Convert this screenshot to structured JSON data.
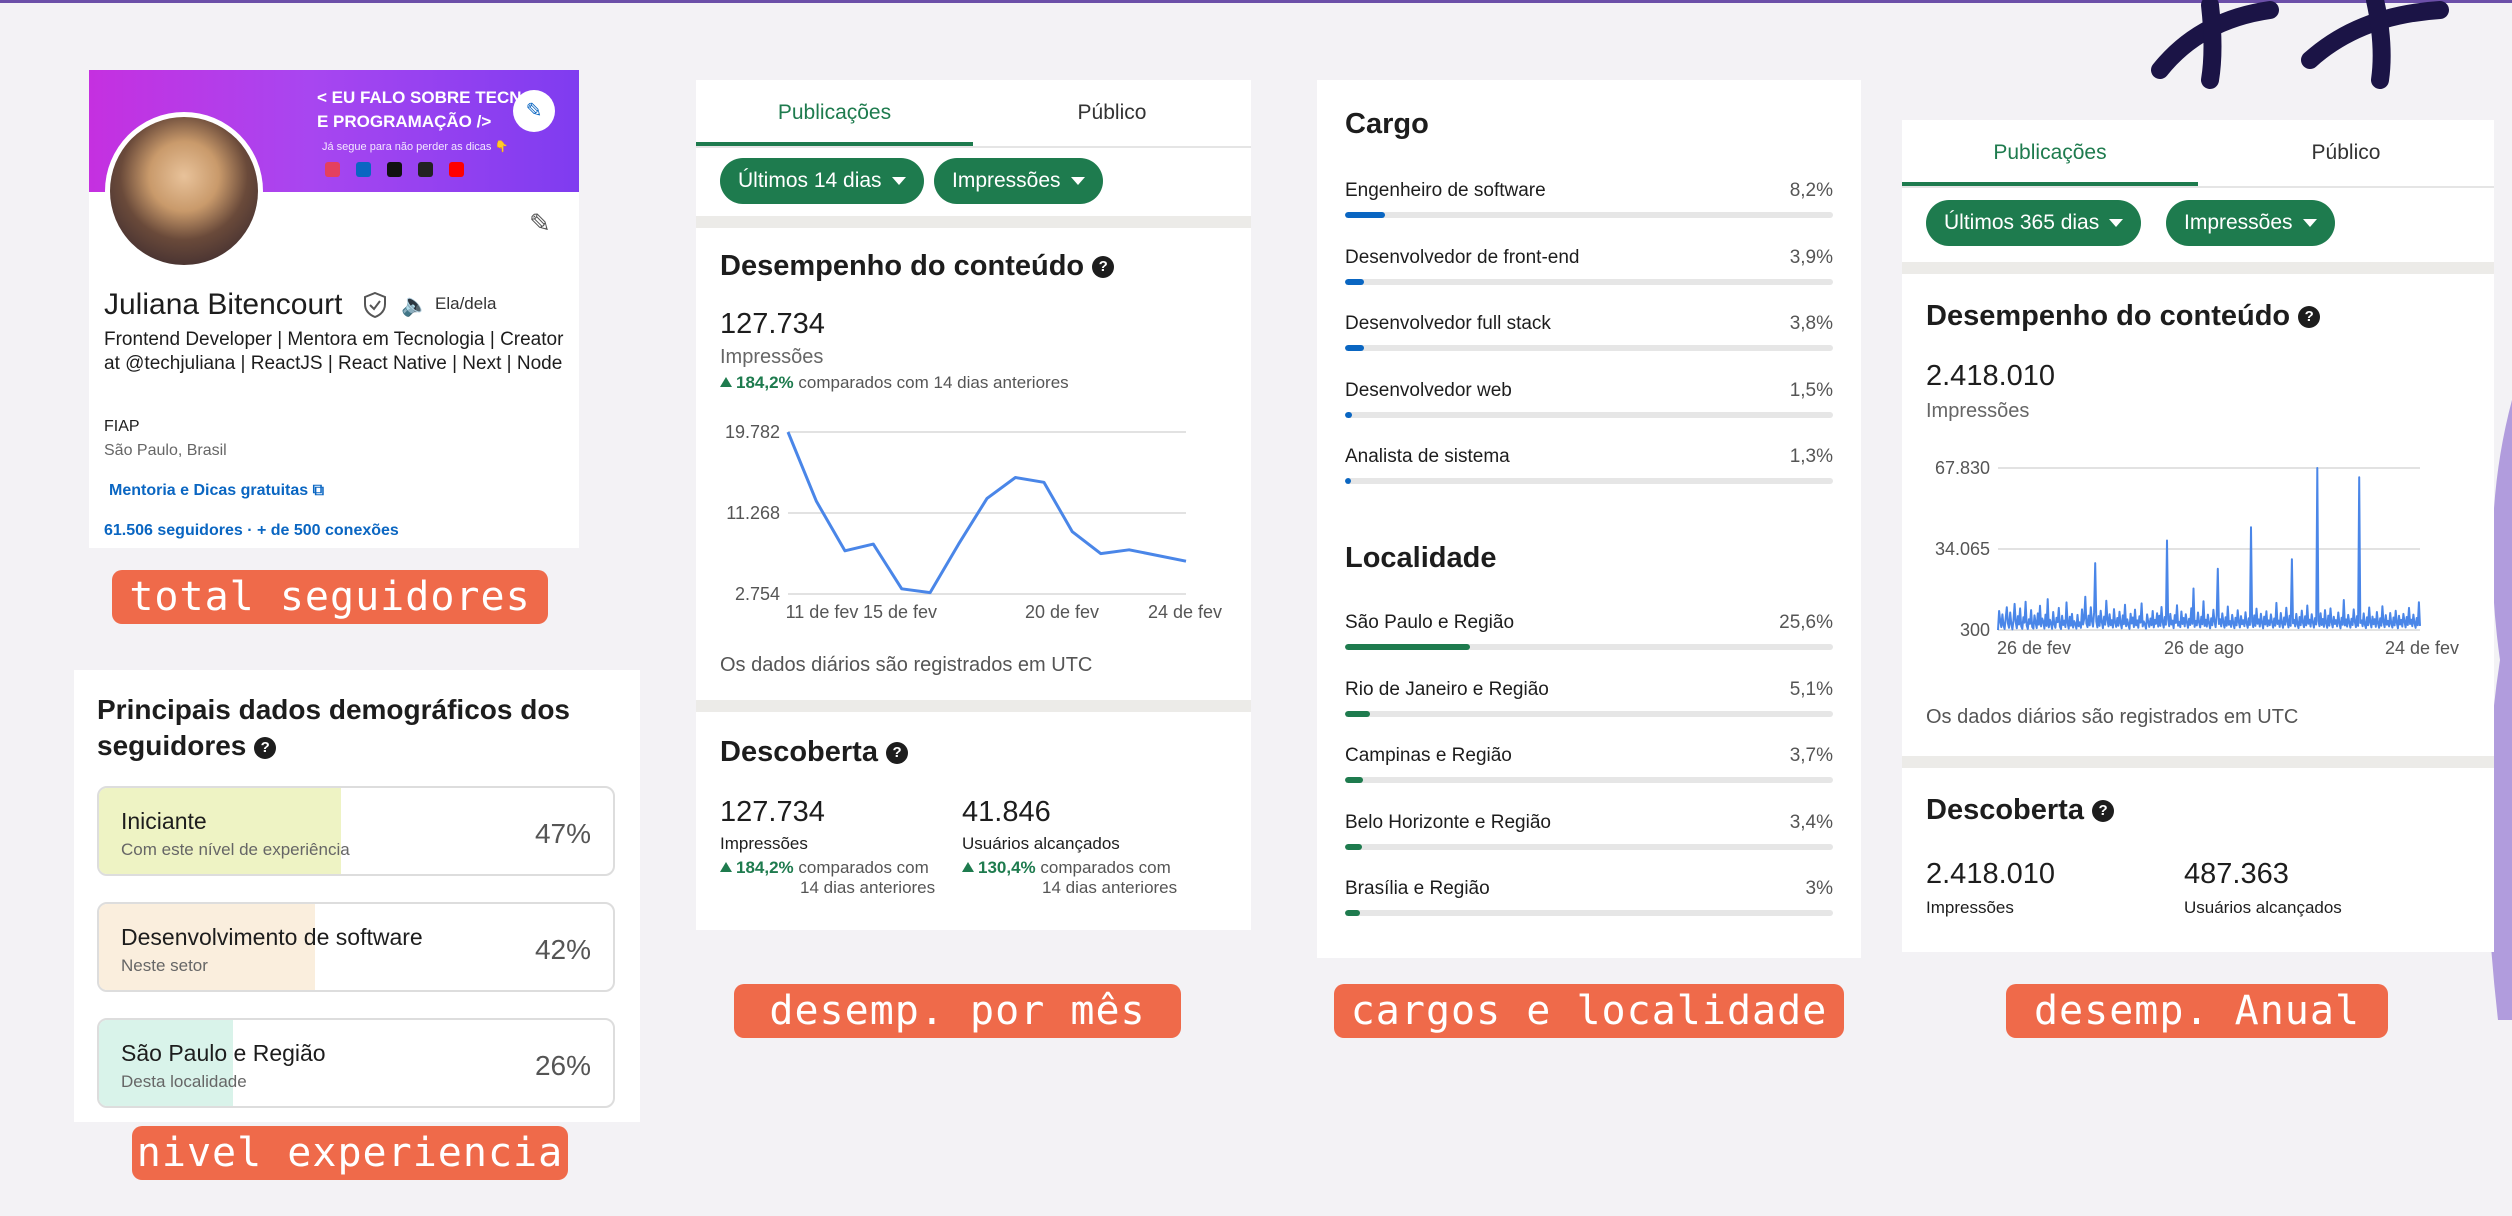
{
  "tags": {
    "followers": "total seguidores",
    "experience": "nivel experiencia",
    "monthly": "desemp. por mês",
    "roles": "cargos e localidade",
    "annual": "desemp. Anual"
  },
  "profile": {
    "banner_text": "< EU FALO SOBRE TECNOL\nE PROGRAMAÇÃO />",
    "banner_sub": "Já segue para não perder as dicas 👇",
    "name": "Juliana Bitencourt",
    "pronouns": "Ela/dela",
    "headline": "Frontend Developer | Mentora em Tecnologia | Creator at @techjuliana | ReactJS | React Native | Next | Node",
    "school": "FIAP",
    "location": "São Paulo, Brasil",
    "link": "Mentoria e Dicas gratuitas",
    "stats": "61.506 seguidores · + de 500 conexões"
  },
  "demographics": {
    "title": "Principais dados demográficos dos seguidores",
    "rows": [
      {
        "label": "Iniciante",
        "sub": "Com este nível de experiência",
        "pct": "47%",
        "value": 47,
        "color": "#eef3c4"
      },
      {
        "label": "Desenvolvimento de software",
        "sub": "Neste setor",
        "pct": "42%",
        "value": 42,
        "color": "#faeedd"
      },
      {
        "label": "São Paulo e Região",
        "sub": "Desta localidade",
        "pct": "26%",
        "value": 26,
        "color": "#d9f3ea"
      }
    ]
  },
  "monthly": {
    "tabs": [
      "Publicações",
      "Público"
    ],
    "filter_period": "Últimos 14 dias",
    "filter_metric": "Impressões",
    "title": "Desempenho do conteúdo",
    "total": "127.734",
    "total_label": "Impressões",
    "delta_pct": "184,2%",
    "delta_text": "comparados com 14 dias anteriores",
    "note": "Os dados diários são registrados em UTC",
    "discovery_title": "Descoberta",
    "impressions": "127.734",
    "impressions_label": "Impressões",
    "impressions_delta": "184,2%",
    "impressions_delta_text1": "comparados com",
    "impressions_delta_text2": "14 dias anteriores",
    "reached": "41.846",
    "reached_label": "Usuários alcançados",
    "reached_delta": "130,4%",
    "reached_delta_text1": "comparados com",
    "reached_delta_text2": "14 dias anteriores"
  },
  "roles": {
    "cargo_title": "Cargo",
    "cargo_color": "#0a66c2",
    "cargos": [
      {
        "name": "Engenheiro de software",
        "pct": "8,2%",
        "value": 8.2
      },
      {
        "name": "Desenvolvedor de front-end",
        "pct": "3,9%",
        "value": 3.9
      },
      {
        "name": "Desenvolvedor full stack",
        "pct": "3,8%",
        "value": 3.8
      },
      {
        "name": "Desenvolvedor web",
        "pct": "1,5%",
        "value": 1.5
      },
      {
        "name": "Analista de sistema",
        "pct": "1,3%",
        "value": 1.3
      }
    ],
    "loc_title": "Localidade",
    "loc_color": "#1e7b4e",
    "locs": [
      {
        "name": "São Paulo e Região",
        "pct": "25,6%",
        "value": 25.6
      },
      {
        "name": "Rio de Janeiro e Região",
        "pct": "5,1%",
        "value": 5.1
      },
      {
        "name": "Campinas e Região",
        "pct": "3,7%",
        "value": 3.7
      },
      {
        "name": "Belo Horizonte e Região",
        "pct": "3,4%",
        "value": 3.4
      },
      {
        "name": "Brasília e Região",
        "pct": "3%",
        "value": 3
      }
    ]
  },
  "annual": {
    "tabs": [
      "Publicações",
      "Público"
    ],
    "filter_period": "Últimos 365 dias",
    "filter_metric": "Impressões",
    "title": "Desempenho do conteúdo",
    "total": "2.418.010",
    "total_label": "Impressões",
    "note": "Os dados diários são registrados em UTC",
    "discovery_title": "Descoberta",
    "impressions": "2.418.010",
    "impressions_label": "Impressões",
    "reached": "487.363",
    "reached_label": "Usuários alcançados"
  },
  "chart_data": [
    {
      "type": "line",
      "color": "#4a86e8",
      "x_ticks": [
        "11 de fev",
        "15 de fev",
        "20 de fev",
        "24 de fev"
      ],
      "y_ticks": [
        "19.782",
        "11.268",
        "2.754"
      ],
      "ylim": [
        2754,
        19782
      ],
      "x": [
        "10 de fev",
        "11 de fev",
        "12 de fev",
        "13 de fev",
        "14 de fev",
        "15 de fev",
        "16 de fev",
        "17 de fev",
        "18 de fev",
        "19 de fev",
        "20 de fev",
        "21 de fev",
        "22 de fev",
        "23 de fev",
        "24 de fev"
      ],
      "values": [
        19782,
        12500,
        7300,
        8000,
        3300,
        2900,
        8000,
        12800,
        15000,
        14500,
        9300,
        7000,
        7400,
        6800,
        6200
      ]
    },
    {
      "type": "line",
      "color": "#4a86e8",
      "x_ticks": [
        "26 de fev",
        "26 de ago",
        "24 de fev"
      ],
      "y_ticks": [
        "67.830",
        "34.065",
        "300"
      ],
      "ylim": [
        300,
        67830
      ],
      "x_start": "26 de fev",
      "x_end": "24 de fev",
      "values": [
        300,
        8200,
        4100,
        1500,
        6800,
        2300,
        700,
        5200,
        9800,
        3100,
        1200,
        7600,
        2800,
        600,
        4400,
        11200,
        3700,
        1000,
        6100,
        2600,
        9300,
        1900,
        800,
        5600,
        3400,
        12100,
        2200,
        700,
        4800,
        2900,
        8600,
        1600,
        900,
        6400,
        3300,
        1100,
        7200,
        2500,
        10400,
        1800,
        5100,
        3800,
        900,
        6700,
        2000,
        13200,
        1400,
        4600,
        3000,
        800,
        7800,
        2700,
        1200,
        5400,
        3600,
        9500,
        1700,
        700,
        6200,
        2400,
        4200,
        1500,
        11800,
        3200,
        900,
        5800,
        2100,
        7000,
        1300,
        4000,
        2800,
        900,
        6600,
        1900,
        3500,
        1200,
        8900,
        2600,
        5000,
        14200,
        3100,
        1500,
        6300,
        2200,
        9800,
        4100,
        1700,
        7500,
        28200,
        3900,
        1400,
        6100,
        2000,
        8300,
        3700,
        1100,
        5900,
        2500,
        12500,
        4600,
        1800,
        6900,
        2300,
        4400,
        1300,
        9000,
        3300,
        1600,
        5300,
        2100,
        7900,
        3100,
        1000,
        6400,
        2700,
        10800,
        1900,
        4700,
        2400,
        800,
        7100,
        3000,
        5500,
        1500,
        8800,
        2200,
        4300,
        1200,
        6000,
        3400,
        11400,
        1800,
        3900,
        2600,
        900,
        6800,
        3800,
        1600,
        5100,
        2300,
        8200,
        1400,
        4500,
        2900,
        7300,
        1700,
        6200,
        2000,
        9900,
        3600,
        1300,
        5700,
        2500,
        37600,
        4800,
        1900,
        7000,
        2600,
        4200,
        1100,
        6500,
        3200,
        10600,
        2100,
        3700,
        1500,
        8000,
        2800,
        5300,
        1800,
        6900,
        3500,
        1200,
        5000,
        2400,
        9400,
        2900,
        17600,
        1600,
        4100,
        2200,
        7600,
        3300,
        1400,
        5800,
        2700,
        12300,
        2000,
        4600,
        1700,
        6700,
        3100,
        1000,
        5200,
        2300,
        8700,
        3900,
        1500,
        6300,
        25800,
        2800,
        4800,
        1800,
        7200,
        3400,
        1300,
        5600,
        2100,
        10100,
        2500,
        4000,
        1600,
        6600,
        3000,
        1100,
        5400,
        2200,
        8500,
        3600,
        1400,
        6100,
        2700,
        4400,
        1900,
        7700,
        3200,
        1200,
        5200,
        2400,
        43100,
        3700,
        1500,
        6400,
        2000,
        9200,
        2900,
        4700,
        1700,
        7100,
        3300,
        1000,
        5900,
        2600,
        8100,
        1900,
        4300,
        2300,
        6800,
        3500,
        1300,
        5100,
        2100,
        11600,
        2800,
        4200,
        1600,
        7400,
        3200,
        1200,
        5500,
        2500,
        9600,
        3800,
        1400,
        6200,
        2000,
        29800,
        3100,
        4500,
        1800,
        7000,
        2700,
        1100,
        5700,
        2300,
        8400,
        3400,
        1500,
        6000,
        2200,
        10500,
        2900,
        4600,
        1700,
        6900,
        3600,
        1300,
        5300,
        2600,
        67830,
        4100,
        1900,
        7300,
        2400,
        4900,
        1600,
        8600,
        3000,
        1200,
        6300,
        2100,
        9300,
        3500,
        1400,
        5800,
        2800,
        4400,
        1800,
        7600,
        3100,
        1000,
        5400,
        2500,
        12800,
        2200,
        4700,
        1700,
        6600,
        3300,
        1300,
        5000,
        2400,
        8900,
        3700,
        1500,
        6100,
        2000,
        64000,
        3200,
        4300,
        1900,
        7200,
        2600,
        1100,
        5600,
        2300,
        9700,
        3400,
        1400,
        5900,
        2700,
        4800,
        1600,
        7800,
        3000,
        1200,
        5200,
        2100,
        10200,
        3600,
        1500,
        6500,
        2500,
        4100,
        1800,
        7400,
        2900,
        1300,
        5500,
        2200,
        8300,
        3300,
        1000,
        6200,
        2600,
        4500,
        1700,
        7000,
        3800,
        1400,
        5700,
        2400,
        9500,
        2800,
        4600,
        1900,
        6700,
        3100,
        1200,
        5300,
        2300,
        11900,
        2000
      ]
    }
  ]
}
